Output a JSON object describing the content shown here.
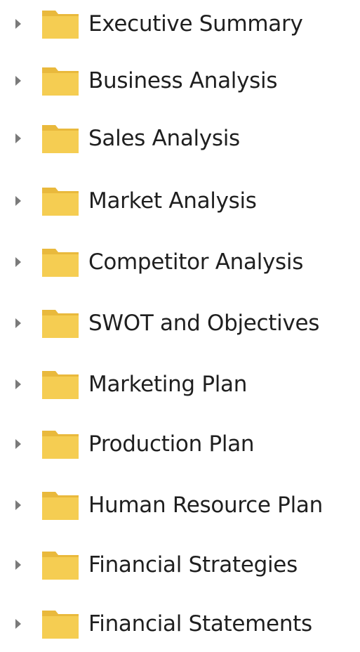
{
  "tree": {
    "items": [
      {
        "label": "Executive Summary",
        "icon": "folder-icon"
      },
      {
        "label": "Business Analysis",
        "icon": "folder-icon"
      },
      {
        "label": "Sales Analysis",
        "icon": "folder-icon"
      },
      {
        "label": "Market Analysis",
        "icon": "folder-icon"
      },
      {
        "label": "Competitor Analysis",
        "icon": "folder-icon"
      },
      {
        "label": "SWOT and Objectives",
        "icon": "folder-icon"
      },
      {
        "label": "Marketing Plan",
        "icon": "folder-icon"
      },
      {
        "label": "Production Plan",
        "icon": "folder-icon"
      },
      {
        "label": "Human Resource Plan",
        "icon": "folder-icon"
      },
      {
        "label": "Financial Strategies",
        "icon": "folder-icon"
      },
      {
        "label": "Financial Statements",
        "icon": "folder-icon"
      }
    ]
  },
  "colors": {
    "folder_body": "#f5cd52",
    "folder_tab": "#e9b93c",
    "arrow": "#7a7a7a",
    "text": "#1f1f1f"
  }
}
